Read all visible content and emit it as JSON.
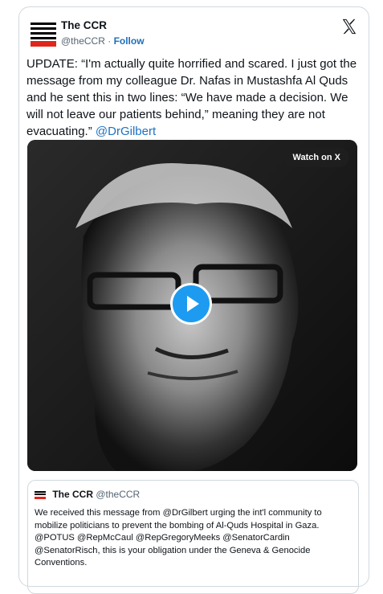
{
  "tweet": {
    "author_name": "The CCR",
    "author_handle": "@theCCR",
    "separator": "·",
    "follow_label": "Follow",
    "text": "UPDATE: “I'm actually quite horrified and scared. I just got the message from my colleague Dr. Nafas in Mustashfa Al Quds and he sent this in two lines: “We have made a decision. We will not leave our patients behind,” meaning they are not evacuating.”",
    "mention": "@DrGilbert"
  },
  "video": {
    "watch_label": "Watch on X",
    "play_icon": "play-icon"
  },
  "quote": {
    "author_name": "The CCR",
    "author_handle": "@theCCR",
    "text": "We received this message from @DrGilbert urging the int'l community to mobilize politicians to prevent the bombing of Al-Quds Hospital in Gaza. @POTUS @RepMcCaul @RepGregoryMeeks @SenatorCardin @SenatorRisch, this is your obligation under the Geneva & Genocide Conventions."
  },
  "colors": {
    "accent": "#1d9bf0",
    "link": "#1d72c2",
    "brand_red": "#e0261b"
  }
}
